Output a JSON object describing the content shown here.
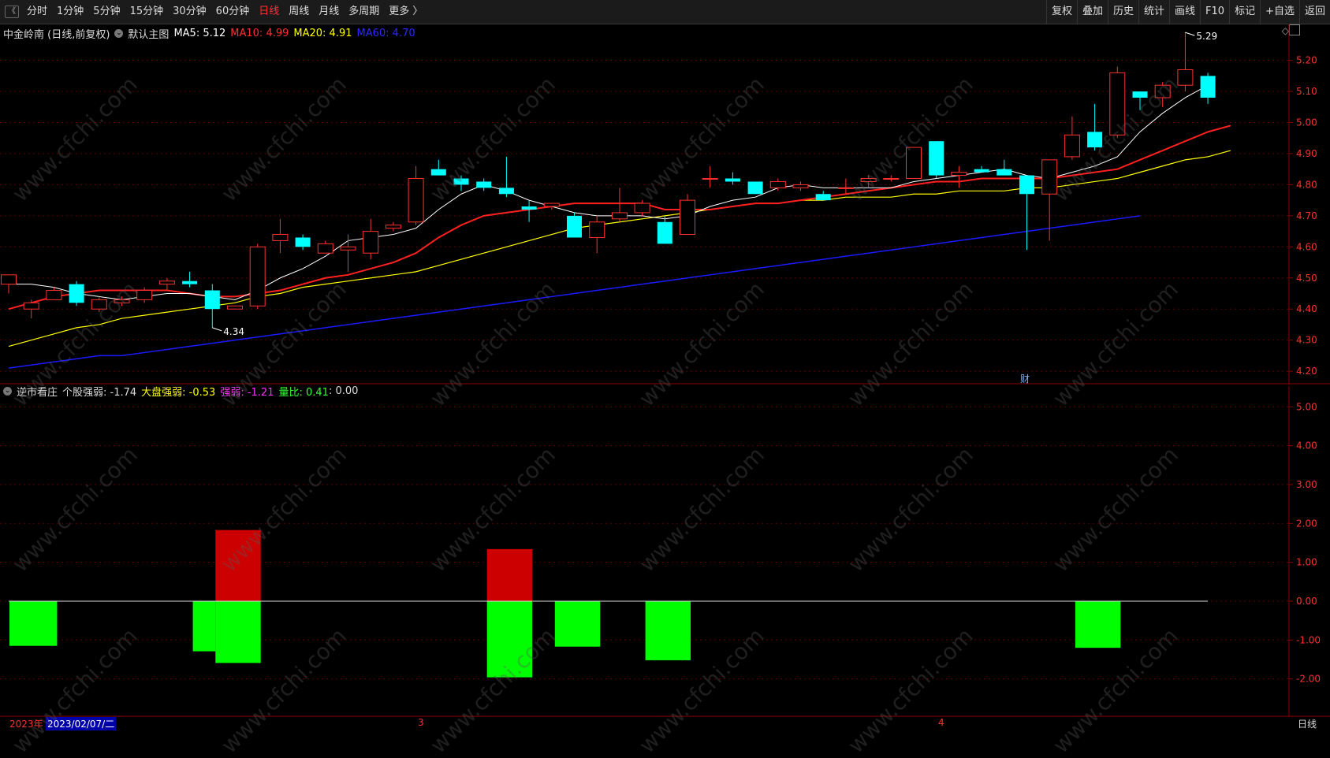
{
  "toolbar": {
    "periods": [
      "分时",
      "1分钟",
      "5分钟",
      "15分钟",
      "30分钟",
      "60分钟",
      "日线",
      "周线",
      "月线",
      "多周期",
      "更多 〉"
    ],
    "active_period": "日线",
    "right_buttons": [
      "复权",
      "叠加",
      "历史",
      "统计",
      "画线",
      "F10",
      "标记",
      "+自选",
      "返回"
    ]
  },
  "main_info": {
    "stock": "中金岭南 (日线,前复权)",
    "template": "默认主图",
    "ma5": "MA5: 5.12",
    "ma10": "MA10: 4.99",
    "ma20": "MA20: 4.91",
    "ma60": "MA60: 4.70"
  },
  "sub_info": {
    "name": "逆市看庄",
    "gegu": "个股强弱: -1.74",
    "dapan": "大盘强弱: -0.53",
    "qiangruo": "强弱: -1.21",
    "liangbi": "量比: 0.41",
    "extra": ": 0.00"
  },
  "colors": {
    "up": "#ff3030",
    "down": "#00ffff",
    "ma5": "#ffffff",
    "ma10": "#ff2020",
    "ma20": "#ffff00",
    "ma60": "#1a1aff",
    "green_bar": "#00ff00",
    "red_bar": "#cc0000"
  },
  "price_labels": {
    "high": "5.29",
    "low": "4.34",
    "fin_mark": "财"
  },
  "watermark": "www.cfchi.com",
  "chart_data": [
    {
      "type": "candlestick",
      "ylim": [
        4.18,
        5.27
      ],
      "y_ticks": [
        "5.20",
        "5.10",
        "5.00",
        "4.90",
        "4.80",
        "4.70",
        "4.60",
        "4.50",
        "4.40",
        "4.30",
        "4.20"
      ],
      "candles": [
        [
          4.48,
          4.51,
          4.45,
          4.51
        ],
        [
          4.4,
          4.43,
          4.37,
          4.42
        ],
        [
          4.43,
          4.47,
          4.43,
          4.46
        ],
        [
          4.48,
          4.49,
          4.41,
          4.42
        ],
        [
          4.4,
          4.44,
          4.39,
          4.43
        ],
        [
          4.42,
          4.44,
          4.41,
          4.43
        ],
        [
          4.43,
          4.47,
          4.42,
          4.46
        ],
        [
          4.48,
          4.5,
          4.46,
          4.49
        ],
        [
          4.49,
          4.52,
          4.47,
          4.48
        ],
        [
          4.46,
          4.48,
          4.34,
          4.4
        ],
        [
          4.4,
          4.41,
          4.4,
          4.41
        ],
        [
          4.41,
          4.61,
          4.4,
          4.6
        ],
        [
          4.62,
          4.69,
          4.58,
          4.64
        ],
        [
          4.63,
          4.64,
          4.59,
          4.6
        ],
        [
          4.58,
          4.62,
          4.58,
          4.61
        ],
        [
          4.59,
          4.64,
          4.52,
          4.6
        ],
        [
          4.58,
          4.69,
          4.56,
          4.65
        ],
        [
          4.66,
          4.68,
          4.65,
          4.67
        ],
        [
          4.68,
          4.86,
          4.67,
          4.82
        ],
        [
          4.85,
          4.88,
          4.83,
          4.83
        ],
        [
          4.82,
          4.83,
          4.78,
          4.8
        ],
        [
          4.81,
          4.82,
          4.78,
          4.79
        ],
        [
          4.79,
          4.89,
          4.76,
          4.77
        ],
        [
          4.73,
          4.75,
          4.68,
          4.72
        ],
        [
          4.73,
          4.74,
          4.72,
          4.74
        ],
        [
          4.7,
          4.71,
          4.63,
          4.63
        ],
        [
          4.63,
          4.7,
          4.58,
          4.68
        ],
        [
          4.69,
          4.79,
          4.68,
          4.71
        ],
        [
          4.71,
          4.75,
          4.7,
          4.74
        ],
        [
          4.68,
          4.7,
          4.61,
          4.61
        ],
        [
          4.64,
          4.77,
          4.64,
          4.75
        ],
        [
          4.82,
          4.86,
          4.79,
          4.82
        ],
        [
          4.82,
          4.84,
          4.8,
          4.81
        ],
        [
          4.81,
          4.81,
          4.77,
          4.77
        ],
        [
          4.79,
          4.82,
          4.78,
          4.81
        ],
        [
          4.79,
          4.81,
          4.78,
          4.8
        ],
        [
          4.77,
          4.78,
          4.75,
          4.75
        ],
        [
          4.79,
          4.82,
          4.77,
          4.79
        ],
        [
          4.81,
          4.83,
          4.79,
          4.82
        ],
        [
          4.82,
          4.83,
          4.81,
          4.82
        ],
        [
          4.82,
          4.92,
          4.82,
          4.92
        ],
        [
          4.94,
          4.94,
          4.82,
          4.83
        ],
        [
          4.83,
          4.86,
          4.79,
          4.84
        ],
        [
          4.85,
          4.86,
          4.84,
          4.84
        ],
        [
          4.85,
          4.88,
          4.84,
          4.83
        ],
        [
          4.83,
          4.82,
          4.59,
          4.77
        ],
        [
          4.77,
          4.87,
          4.62,
          4.88
        ],
        [
          4.89,
          5.02,
          4.88,
          4.96
        ],
        [
          4.97,
          5.06,
          4.91,
          4.92
        ],
        [
          4.96,
          5.18,
          4.95,
          5.16
        ],
        [
          5.1,
          5.09,
          5.04,
          5.08
        ],
        [
          5.08,
          5.13,
          5.05,
          5.12
        ],
        [
          5.12,
          5.29,
          5.1,
          5.17
        ],
        [
          5.15,
          5.16,
          5.06,
          5.08
        ]
      ],
      "ma5": [
        4.48,
        4.48,
        4.47,
        4.45,
        4.44,
        4.43,
        4.44,
        4.45,
        4.45,
        4.44,
        4.43,
        4.46,
        4.5,
        4.53,
        4.57,
        4.62,
        4.63,
        4.64,
        4.66,
        4.72,
        4.77,
        4.8,
        4.78,
        4.75,
        4.73,
        4.71,
        4.7,
        4.7,
        4.7,
        4.69,
        4.7,
        4.73,
        4.75,
        4.76,
        4.79,
        4.8,
        4.79,
        4.79,
        4.79,
        4.79,
        4.81,
        4.82,
        4.83,
        4.84,
        4.85,
        4.83,
        4.82,
        4.84,
        4.86,
        4.89,
        4.97,
        5.03,
        5.08,
        5.12
      ],
      "ma10": [
        4.4,
        4.42,
        4.44,
        4.45,
        4.46,
        4.46,
        4.46,
        4.46,
        4.45,
        4.44,
        4.44,
        4.45,
        4.46,
        4.48,
        4.5,
        4.51,
        4.53,
        4.55,
        4.58,
        4.63,
        4.67,
        4.7,
        4.71,
        4.72,
        4.73,
        4.74,
        4.74,
        4.74,
        4.74,
        4.72,
        4.72,
        4.72,
        4.73,
        4.74,
        4.74,
        4.75,
        4.76,
        4.77,
        4.78,
        4.79,
        4.8,
        4.81,
        4.81,
        4.82,
        4.82,
        4.82,
        4.82,
        4.83,
        4.84,
        4.85,
        4.88,
        4.91,
        4.94,
        4.97,
        4.99
      ],
      "ma20": [
        4.28,
        4.3,
        4.32,
        4.34,
        4.35,
        4.37,
        4.38,
        4.39,
        4.4,
        4.41,
        4.42,
        4.44,
        4.45,
        4.47,
        4.48,
        4.49,
        4.5,
        4.51,
        4.52,
        4.54,
        4.56,
        4.58,
        4.6,
        4.62,
        4.64,
        4.66,
        4.67,
        4.68,
        4.69,
        4.7,
        4.71,
        4.72,
        4.73,
        4.74,
        4.74,
        4.75,
        4.75,
        4.76,
        4.76,
        4.76,
        4.77,
        4.77,
        4.78,
        4.78,
        4.78,
        4.79,
        4.79,
        4.8,
        4.81,
        4.82,
        4.84,
        4.86,
        4.88,
        4.89,
        4.91
      ],
      "ma60": [
        4.21,
        4.22,
        4.23,
        4.24,
        4.25,
        4.25,
        4.26,
        4.27,
        4.28,
        4.29,
        4.3,
        4.31,
        4.32,
        4.33,
        4.34,
        4.35,
        4.36,
        4.37,
        4.38,
        4.39,
        4.4,
        4.41,
        4.42,
        4.43,
        4.44,
        4.45,
        4.46,
        4.47,
        4.48,
        4.49,
        4.5,
        4.51,
        4.52,
        4.53,
        4.54,
        4.55,
        4.56,
        4.57,
        4.58,
        4.59,
        4.6,
        4.61,
        4.62,
        4.63,
        4.64,
        4.65,
        4.66,
        4.67,
        4.68,
        4.69,
        4.7
      ]
    },
    {
      "type": "bar",
      "ylim": [
        -2.9,
        5.25
      ],
      "y_ticks": [
        "5.00",
        "4.00",
        "3.00",
        "2.00",
        "1.00",
        "0.00",
        "-1.00",
        "-2.00"
      ],
      "bars": [
        {
          "from_index": 0,
          "to_index": 2,
          "value": -1.15,
          "color": "green"
        },
        {
          "from_index": 8,
          "to_index": 9,
          "value": -1.29,
          "color": "green"
        },
        {
          "from_index": 9,
          "to_index": 11,
          "value": 1.83,
          "color": "red"
        },
        {
          "from_index": 9,
          "to_index": 11,
          "value": -1.59,
          "color": "green"
        },
        {
          "from_index": 21,
          "to_index": 23,
          "value": 1.34,
          "color": "red"
        },
        {
          "from_index": 21,
          "to_index": 23,
          "value": -1.96,
          "color": "green"
        },
        {
          "from_index": 24,
          "to_index": 26,
          "value": -1.17,
          "color": "green"
        },
        {
          "from_index": 28,
          "to_index": 30,
          "value": -1.52,
          "color": "green"
        },
        {
          "from_index": 47,
          "to_index": 49,
          "value": -1.2,
          "color": "green"
        }
      ]
    }
  ],
  "bottom_axis": {
    "year": "2023年",
    "date": "2023/02/07/二",
    "month3": "3",
    "month4": "4",
    "period": "日线"
  }
}
